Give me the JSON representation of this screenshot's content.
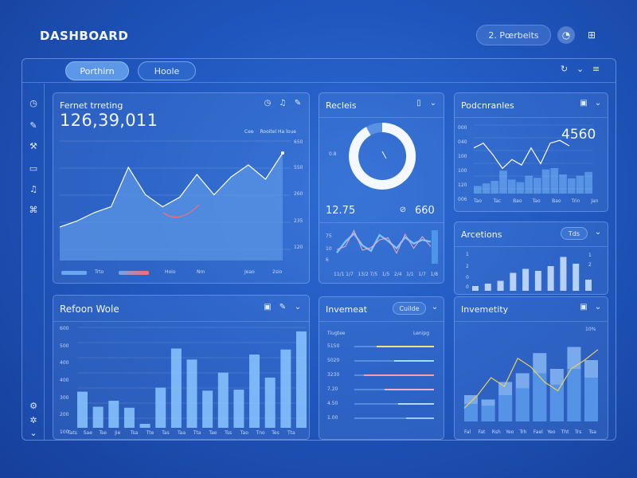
{
  "app": {
    "title": "DASHBOARD"
  },
  "topbar": {
    "pill_label": "2. Pœrbeits",
    "icons": [
      "user-circle-icon",
      "windows-icon"
    ]
  },
  "tabs": [
    {
      "label": "Porthirn",
      "active": true
    },
    {
      "label": "Hoole",
      "active": false
    }
  ],
  "frame_controls": [
    "refresh-icon",
    "chevron-down-icon",
    "menu-icon"
  ],
  "sidebar_icons": [
    "clock-icon",
    "edit-icon",
    "wrench-icon",
    "card-icon",
    "music-icon",
    "puzzle-icon",
    "settings-icon",
    "gear-icon",
    "chevron-down-icon"
  ],
  "panels": {
    "trading": {
      "title": "Fernet trreting",
      "value": "126,39,011",
      "legend": [
        "Cee",
        "Rooitel Ha loue"
      ],
      "y_ticks": [
        "650",
        "550",
        "260",
        "235",
        "120"
      ],
      "x_ticks": [
        "Trto",
        "Hoio",
        "Nm",
        "Jeao",
        "2sio"
      ],
      "colors": {
        "area": "#5b96e4",
        "line": "#ffffff",
        "accent": "#ff6b6b"
      }
    },
    "recieis": {
      "title": "Recleis",
      "donut_label": "0.8",
      "stat_a": "12.75",
      "stat_b": "660",
      "y_ticks": [
        "75",
        "10",
        "6"
      ],
      "x_ticks": [
        "11/1",
        "1/7",
        "13/2",
        "7/5",
        "1/5",
        "2/4",
        "1/1",
        "1/7",
        "1/8"
      ],
      "donut_fraction": 0.92
    },
    "podcasts": {
      "title": "Podcnranles",
      "value": "4560",
      "y_ticks": [
        "000",
        "040",
        "100",
        "100",
        "120",
        "006"
      ],
      "x_ticks": [
        "Tao",
        "Tac",
        "Bao",
        "Tao",
        "Bao",
        "Trin",
        "Jan"
      ]
    },
    "arcetions": {
      "title": "Arcetions",
      "pill": "Tds",
      "y_ticks": [
        "1",
        "2",
        "0",
        "0"
      ],
      "x_ticks": [
        "1",
        "2"
      ]
    },
    "refoon": {
      "title": "Refoon Wole",
      "y_ticks": [
        "600",
        "500",
        "400",
        "400",
        "300",
        "200",
        "100"
      ],
      "x_ticks": [
        "Tats",
        "Sae",
        "Tse",
        "Jie",
        "Tsa",
        "Tte",
        "Tas",
        "Taa",
        "Tta",
        "Tae",
        "Tss",
        "Tao",
        "Tno",
        "Tes",
        "Tta"
      ]
    },
    "invemeat": {
      "title": "Invemeat",
      "pill": "Cuilde",
      "header_left": "Tiugtee",
      "header_right": "Lenipg",
      "rows": [
        {
          "label": "5150",
          "color": "#f1e08a"
        },
        {
          "label": "5020",
          "color": "#9fe0ff"
        },
        {
          "label": "3230",
          "color": "#ff9aa8"
        },
        {
          "label": "7.20",
          "color": "#f4b0c2"
        },
        {
          "label": "4.50",
          "color": "#b4d9ff"
        },
        {
          "label": "1.00",
          "color": "#9cc7ff"
        }
      ]
    },
    "invemetity": {
      "title": "Invemetity",
      "corner_tick": "10%",
      "x_ticks": [
        "Fal",
        "Fat",
        "Rsh",
        "Yeo",
        "Trh",
        "Fael",
        "Yeo",
        "Tht",
        "Trs",
        "Tsa"
      ],
      "line_color": "#e7d35a"
    }
  },
  "chart_data": [
    {
      "type": "area",
      "values": [
        0.28,
        0.33,
        0.4,
        0.45,
        0.78,
        0.55,
        0.45,
        0.53,
        0.72,
        0.55,
        0.7,
        0.8,
        0.68,
        0.9
      ],
      "ylim": [
        0,
        1
      ]
    },
    {
      "type": "line",
      "values": [
        0.3,
        0.6,
        0.82,
        0.5,
        0.35,
        0.78,
        0.62,
        0.42,
        0.72,
        0.55,
        0.65,
        0.6
      ],
      "ylim": [
        0,
        1
      ]
    },
    {
      "type": "line",
      "values": [
        0.55,
        0.62,
        0.45,
        0.25,
        0.38,
        0.3,
        0.55,
        0.32,
        0.62,
        0.66,
        0.58
      ],
      "ylim": [
        0,
        1
      ]
    },
    {
      "type": "bar",
      "values": [
        0.3,
        0.4,
        0.5,
        0.9,
        0.55,
        0.45,
        0.7,
        0.62,
        0.95,
        1.0,
        0.75,
        0.6,
        0.7,
        0.85
      ],
      "ylim": [
        0,
        1
      ]
    },
    {
      "type": "bar",
      "values": [
        0.12,
        0.18,
        0.25,
        0.45,
        0.55,
        0.5,
        0.62,
        0.85,
        0.68,
        0.28
      ],
      "ylim": [
        0,
        1
      ]
    },
    {
      "type": "bar",
      "values": [
        0.36,
        0.21,
        0.27,
        0.2,
        0.04,
        0.4,
        0.79,
        0.68,
        0.37,
        0.55,
        0.38,
        0.73,
        0.5,
        0.78,
        0.96
      ],
      "ylim": [
        0,
        1
      ]
    },
    {
      "type": "bar",
      "values": [
        0.72,
        0.5,
        0.88,
        0.62,
        0.45,
        0.35
      ],
      "ylim": [
        0,
        1
      ]
    },
    {
      "type": "bar",
      "series": [
        {
          "values": [
            0.3,
            0.25,
            0.45,
            0.55,
            0.78,
            0.6,
            0.85,
            0.7
          ]
        },
        {
          "values": [
            0.2,
            0.18,
            0.3,
            0.38,
            0.55,
            0.42,
            0.6,
            0.5
          ]
        }
      ],
      "overlay": [
        0.15,
        0.3,
        0.5,
        0.4,
        0.72,
        0.62,
        0.45,
        0.35,
        0.6,
        0.7,
        0.82
      ],
      "ylim": [
        0,
        1
      ]
    }
  ]
}
